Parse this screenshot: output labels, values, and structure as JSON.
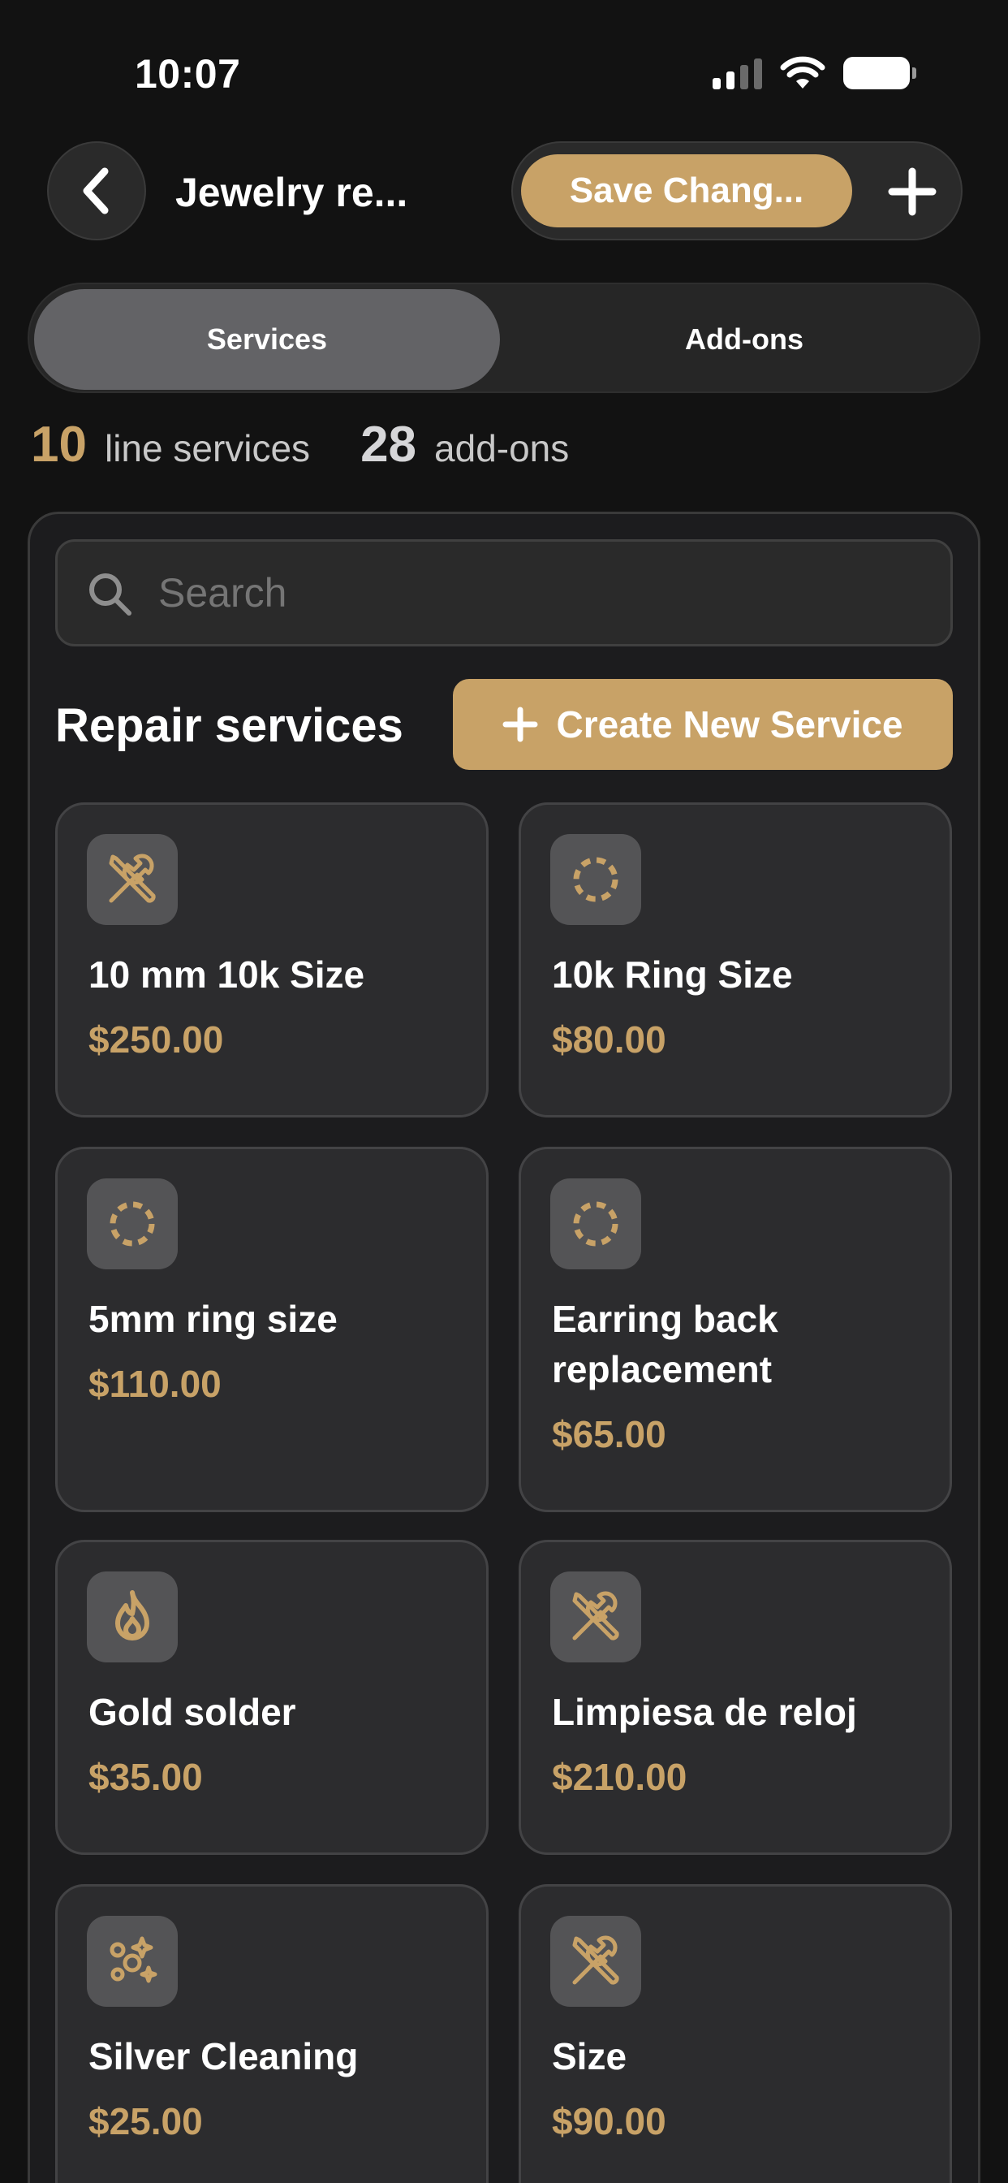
{
  "status_bar": {
    "time": "10:07"
  },
  "header": {
    "title": "Jewelry re...",
    "save_label": "Save Chang...",
    "back_icon": "chevron-left-icon",
    "add_icon": "plus-icon"
  },
  "tabs": [
    {
      "label": "Services",
      "active": true
    },
    {
      "label": "Add-ons",
      "active": false
    }
  ],
  "counts": {
    "services_count": "10",
    "services_label": "line services",
    "addons_count": "28",
    "addons_label": "add-ons"
  },
  "search": {
    "placeholder": "Search",
    "value": ""
  },
  "section": {
    "title": "Repair services",
    "create_label": "Create New Service"
  },
  "services": [
    {
      "name": "10 mm 10k Size",
      "price": "$250.00",
      "icon": "tools-icon"
    },
    {
      "name": "10k Ring Size",
      "price": "$80.00",
      "icon": "ring-icon"
    },
    {
      "name": "5mm ring size",
      "price": "$110.00",
      "icon": "ring-icon"
    },
    {
      "name": "Earring back replacement",
      "price": "$65.00",
      "icon": "ring-icon"
    },
    {
      "name": "Gold solder",
      "price": "$35.00",
      "icon": "flame-icon"
    },
    {
      "name": "Limpiesa de reloj",
      "price": "$210.00",
      "icon": "tools-icon"
    },
    {
      "name": "Silver Cleaning",
      "price": "$25.00",
      "icon": "sparkles-icon"
    },
    {
      "name": "Size",
      "price": "$90.00",
      "icon": "tools-icon"
    }
  ],
  "colors": {
    "accent": "#c8a267",
    "background": "#121212",
    "card": "#2c2c2e"
  }
}
